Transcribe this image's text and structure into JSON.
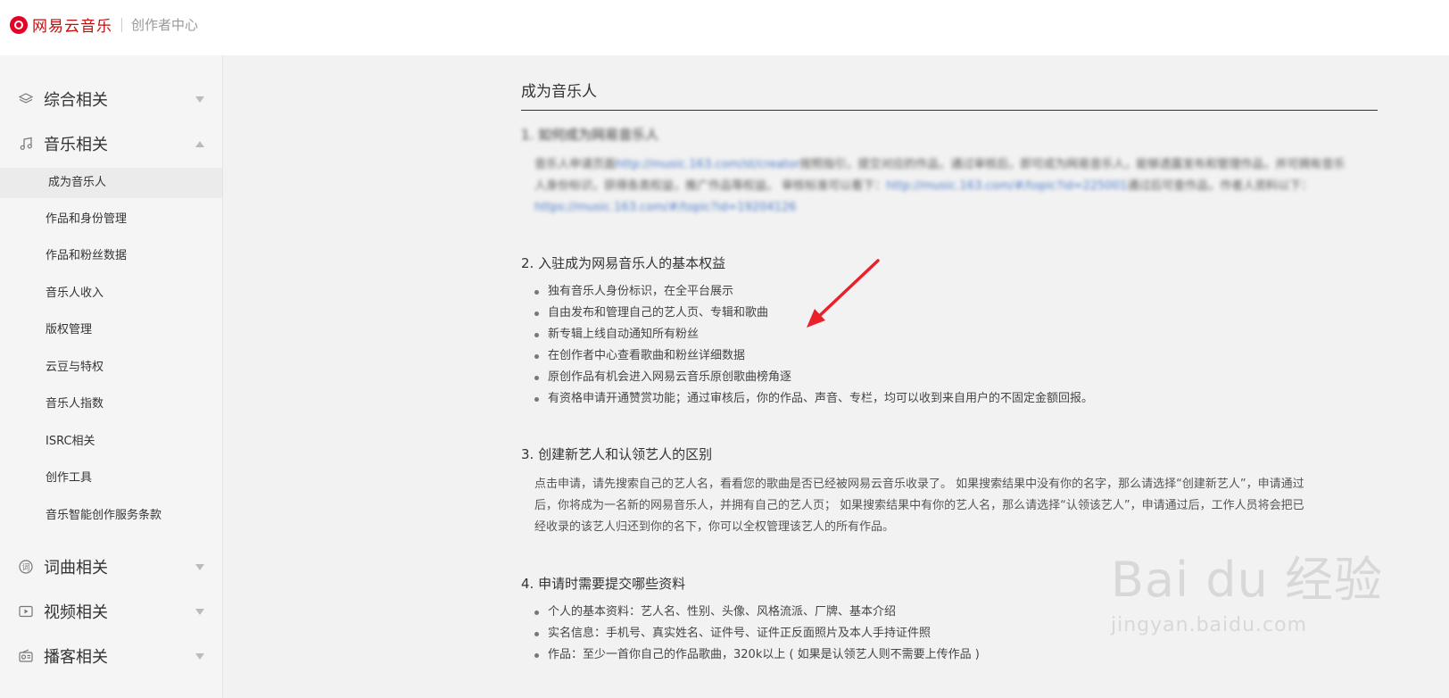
{
  "header": {
    "brand": "网易云音乐",
    "subtitle": "创作者中心"
  },
  "sidebar": {
    "categories": [
      {
        "label": "综合相关",
        "icon": "layers-icon",
        "expanded": false
      },
      {
        "label": "音乐相关",
        "icon": "music-note-icon",
        "expanded": true
      },
      {
        "label": "词曲相关",
        "icon": "lyrics-icon",
        "expanded": false
      },
      {
        "label": "视频相关",
        "icon": "video-icon",
        "expanded": false
      },
      {
        "label": "播客相关",
        "icon": "radio-icon",
        "expanded": false
      }
    ],
    "music_items": [
      "成为音乐人",
      "作品和身份管理",
      "作品和粉丝数据",
      "音乐人收入",
      "版权管理",
      "云豆与特权",
      "音乐人指数",
      "ISRC相关",
      "创作工具",
      "音乐智能创作服务条款"
    ],
    "active_item": "成为音乐人"
  },
  "content": {
    "title": "成为音乐人",
    "s1": {
      "heading": "1. 如何成为网易音乐人",
      "text_a": "音乐人申请页面",
      "link_a": "http://music.163.com/st/creator",
      "text_b": "按照指引，提交对应的作品，通过审核后，即可成为网易音乐人，能够透露发布和管理作品，并可拥有音乐人身份标识，获得各类权益，推广作品等权益。 审核标准可以看下：",
      "link_b": "http://music.163.com/#/topic?id=225001",
      "text_c": "通过后可查作品，作者人资料以下：",
      "link_c": "https://music.163.com/#/topic?id=19204126"
    },
    "s2": {
      "heading": "2. 入驻成为网易音乐人的基本权益",
      "items": [
        "独有音乐人身份标识，在全平台展示",
        "自由发布和管理自己的艺人页、专辑和歌曲",
        "新专辑上线自动通知所有粉丝",
        "在创作者中心查看歌曲和粉丝详细数据",
        "原创作品有机会进入网易云音乐原创歌曲榜角逐",
        "有资格申请开通赞赏功能；通过审核后，你的作品、声音、专栏，均可以收到来自用户的不固定金额回报。"
      ]
    },
    "s3": {
      "heading": "3. 创建新艺人和认领艺人的区别",
      "lines": [
        "点击申请，请先搜索自己的艺人名，看看您的歌曲是否已经被网易云音乐收录了。 如果搜索结果中没有你的名字，那么请选择“创建新艺人”，申请通过",
        "后，你将成为一名新的网易音乐人，并拥有自己的艺人页；  如果搜索结果中有你的艺人名，那么请选择“认领该艺人”，申请通过后，工作人员将会把已",
        "经收录的该艺人归还到你的名下，你可以全权管理该艺人的所有作品。"
      ]
    },
    "s4": {
      "heading": "4. 申请时需要提交哪些资料",
      "items": [
        "个人的基本资料：艺人名、性别、头像、风格流派、厂牌、基本介绍",
        "实名信息：手机号、真实姓名、证件号、证件正反面照片及本人手持证件照",
        "作品：至少一首你自己的作品歌曲，320k以上  ( 如果是认领艺人则不需要上传作品 )"
      ]
    }
  },
  "annotation_color": "#e8212b",
  "watermark": {
    "main": "Bai du 经验",
    "sub": "jingyan.baidu.com"
  }
}
